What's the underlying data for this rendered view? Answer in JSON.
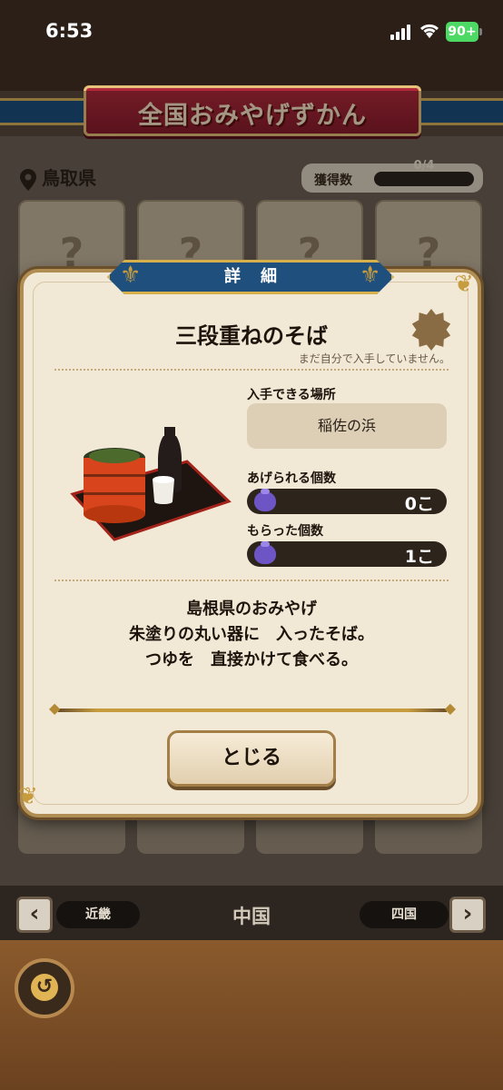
{
  "status_bar": {
    "time": "6:53",
    "battery": "90+"
  },
  "header": {
    "title": "全国おみやげずかん"
  },
  "region": {
    "name": "鳥取県",
    "count_label": "獲得数",
    "count_value": "0/4",
    "progress": 0
  },
  "cards": {
    "placeholder": "?"
  },
  "modal": {
    "header": "詳細",
    "item_name": "三段重ねのそば",
    "not_owned_note": "まだ自分で入手していません。",
    "location_label": "入手できる場所",
    "location_value": "稲佐の浜",
    "giveable_label": "あげられる個数",
    "giveable_value": "0こ",
    "received_label": "もらった個数",
    "received_value": "1こ",
    "description": [
      "島根県のおみやげ",
      "朱塗りの丸い器に　入ったそば。",
      "つゆを　直接かけて食べる。"
    ],
    "close_label": "とじる"
  },
  "bottom_nav": {
    "prev": "近畿",
    "current": "中国",
    "next": "四国"
  },
  "colors": {
    "banner": "#b32b3c",
    "header_blue": "#1f4f7d",
    "gold": "#c79c3e",
    "modal_bg": "#f2e8d6"
  }
}
